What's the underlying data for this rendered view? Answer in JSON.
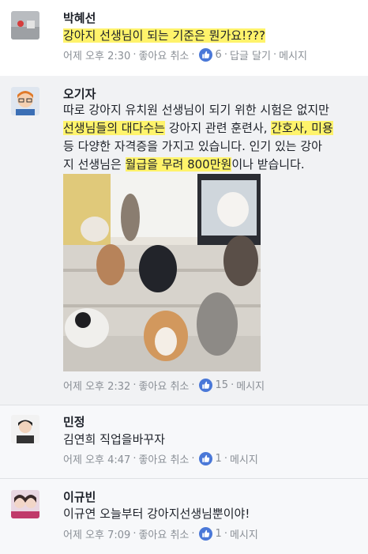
{
  "comments": [
    {
      "author": "박혜선",
      "text": "강아지 선생님이 되는 기준은 뭔가요!???",
      "time": "어제 오후 2:30",
      "like_action": "좋아요 취소",
      "like_count": "6",
      "reply": "답글 달기",
      "message": "메시지"
    },
    {
      "author": "오기자",
      "text_lines": [
        "따로 강아지 유치원 선생님이 되기 위한 시험은 없지만",
        "선생님들의 대다수는 강아지 관련 훈련사, 간호사, 미용",
        "등  다양한 자격증을 가지고 있습니다. 인기 있는 강아",
        "지 선생님은 월급을 무려 800만원이나 받습니다."
      ],
      "line2_hl1": "선생님들의 대다수는",
      "line2_mid": " 강아지 관련 훈련사, ",
      "line2_hl2": "간호사, 미용",
      "line3": "등  다양한 자격증을 가지고 있습니다. 인기 있는 강아",
      "line4_pre": "지 선생님은 ",
      "line4_hl": "월급을 무려 800만원",
      "line4_post": "이나 받습니다.",
      "time": "어제 오후 2:32",
      "like_action": "좋아요 취소",
      "like_count": "15",
      "message": "메시지"
    },
    {
      "author": "민정",
      "text": "김연희 직업을바꾸자",
      "time": "어제 오후 4:47",
      "like_action": "좋아요 취소",
      "like_count": "1",
      "message": "메시지"
    },
    {
      "author": "이규빈",
      "text": "이규연 오늘부터 강아지선생님뿐이야!",
      "time": "어제 오후 7:09",
      "like_action": "좋아요 취소",
      "like_count": "1",
      "message": "메시지"
    }
  ],
  "colors": {
    "highlight": "#fff36b",
    "like_blue": "#4267b2",
    "meta_gray": "#8a8f96"
  },
  "icons": [
    "like-thumb-icon"
  ]
}
